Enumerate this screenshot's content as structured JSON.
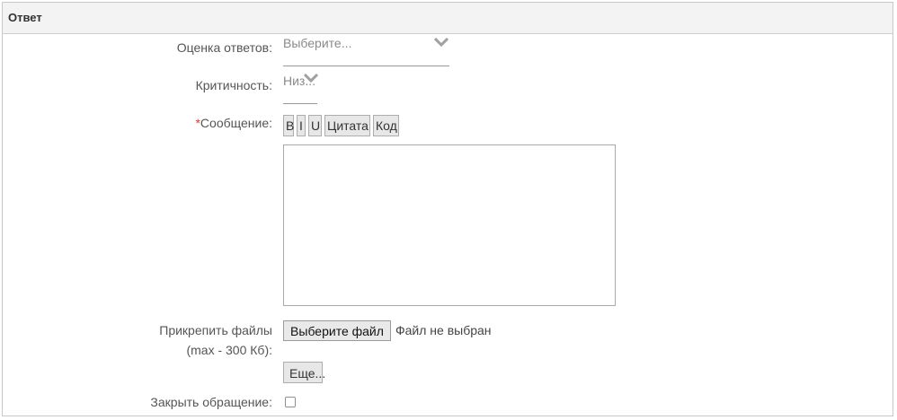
{
  "panel": {
    "title": "Ответ"
  },
  "rating": {
    "label": "Оценка ответов:",
    "value": "Выберите..."
  },
  "criticality": {
    "label": "Критичность:",
    "value": "Низ..."
  },
  "message": {
    "required_mark": "*",
    "label": "Сообщение:",
    "format_buttons": [
      "B",
      "I",
      "U",
      "Цитата",
      "Код"
    ],
    "text": ""
  },
  "attach": {
    "label_line1": "Прикрепить файлы",
    "label_line2": "(max - 300 Кб):",
    "choose_button": "Выберите файл",
    "status": "Файл не выбран",
    "more_button": "Еще..."
  },
  "close_request": {
    "label": "Закрыть обращение:",
    "checked": false
  },
  "colors": {
    "required": "#e03b3b",
    "chevron": "#a0a0a0"
  },
  "icons": {
    "dropdown": "chevron-down-icon"
  }
}
